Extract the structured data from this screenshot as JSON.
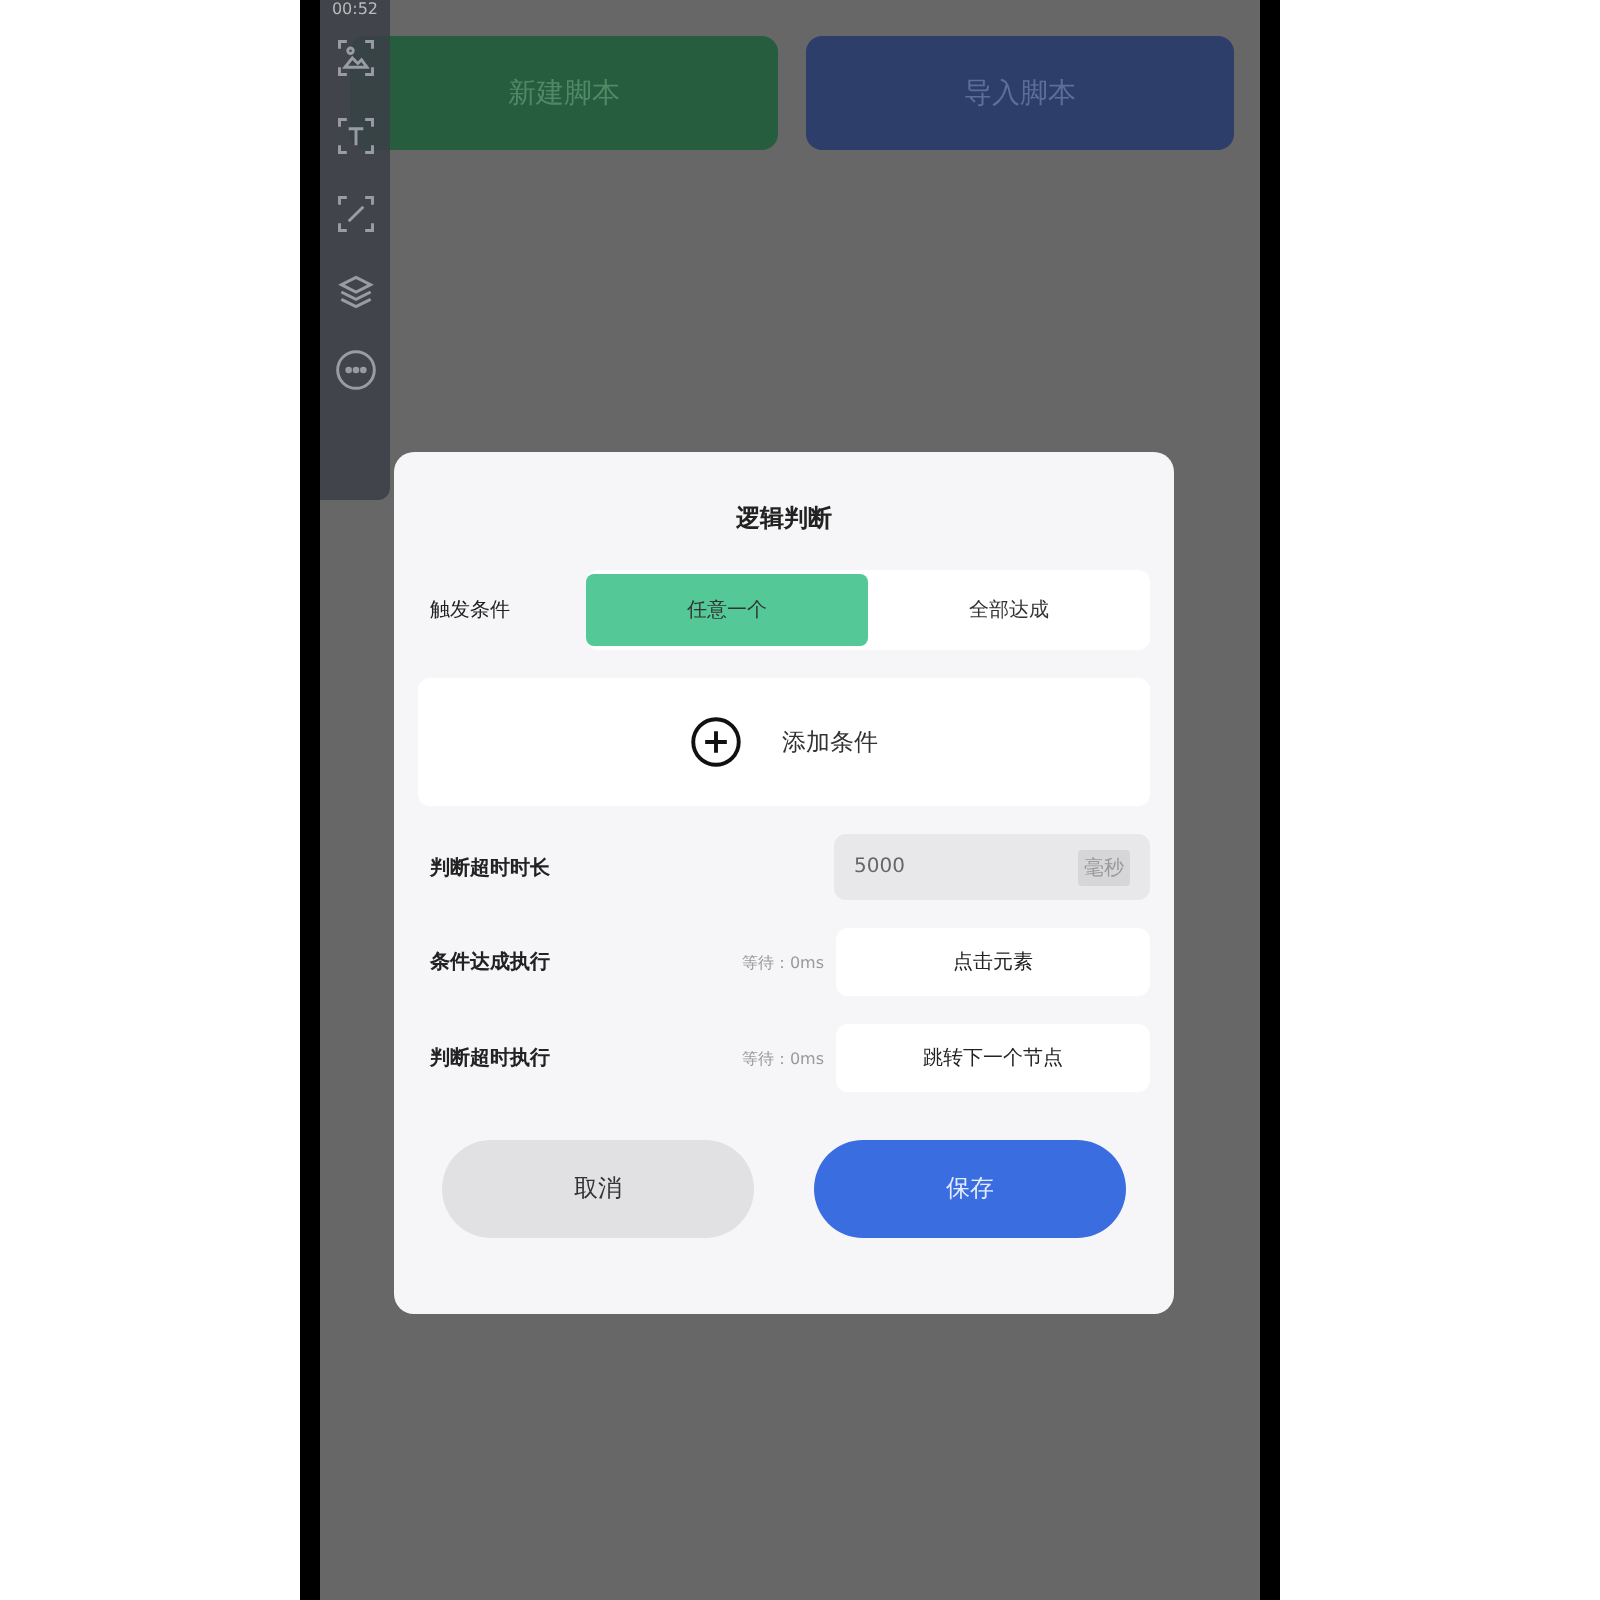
{
  "status_bar": {
    "time": "00:52"
  },
  "background_buttons": [
    {
      "label": "新建脚本",
      "kind": "create"
    },
    {
      "label": "导入脚本",
      "kind": "import"
    }
  ],
  "dialog": {
    "title": "逻辑判断",
    "trigger": {
      "label": "触发条件",
      "options": [
        {
          "label": "任意一个",
          "selected": true
        },
        {
          "label": "全部达成",
          "selected": false
        }
      ]
    },
    "add_condition": "添加条件",
    "timeout": {
      "label": "判断超时时长",
      "value": "5000",
      "unit": "毫秒"
    },
    "actions": [
      {
        "label": "条件达成执行",
        "wait": "等待：0ms",
        "action": "点击元素"
      },
      {
        "label": "判断超时执行",
        "wait": "等待：0ms",
        "action": "跳转下一个节点"
      }
    ],
    "buttons": [
      {
        "label": "取消",
        "kind": "cancel"
      },
      {
        "label": "保存",
        "kind": "primary"
      }
    ]
  }
}
